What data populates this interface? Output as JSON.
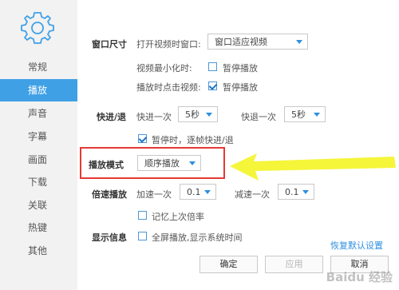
{
  "sidebar": {
    "items": [
      {
        "label": "常规"
      },
      {
        "label": "播放"
      },
      {
        "label": "声音"
      },
      {
        "label": "字幕"
      },
      {
        "label": "画面"
      },
      {
        "label": "下载"
      },
      {
        "label": "关联"
      },
      {
        "label": "热键"
      },
      {
        "label": "其他"
      }
    ],
    "active_item": "播放"
  },
  "window_size": {
    "title": "窗口尺寸",
    "open_label": "打开视频时窗口:",
    "open_value": "窗口适应视频",
    "minimize_label": "视频最小化时:",
    "minimize_option": "暂停播放",
    "minimize_checked": false,
    "click_label": "播放时点击视频:",
    "click_option": "暂停播放",
    "click_checked": true
  },
  "seek": {
    "title": "快进/退",
    "forward_label": "快进一次",
    "forward_value": "5秒",
    "back_label": "快退一次",
    "back_value": "5秒",
    "pause_frame_option": "暂停时，逐帧快进/退",
    "pause_frame_checked": true
  },
  "play_mode": {
    "title": "播放模式",
    "value": "顺序播放"
  },
  "speed": {
    "title": "倍速播放",
    "up_label": "加速一次",
    "up_value": "0.1",
    "down_label": "减速一次",
    "down_value": "0.1",
    "remember_option": "记忆上次倍率",
    "remember_checked": false
  },
  "display": {
    "title": "显示信息",
    "fullscreen_option": "全屏播放,显示系统时间",
    "fullscreen_checked": false
  },
  "footer": {
    "restore_default": "恢复默认设置",
    "ok": "确定",
    "apply": "应用",
    "cancel": "取消"
  },
  "watermark": "Baidu 经验",
  "colors": {
    "accent": "#3fa0e6",
    "highlight_box": "#e53935",
    "arrow": "#f5f53a"
  }
}
